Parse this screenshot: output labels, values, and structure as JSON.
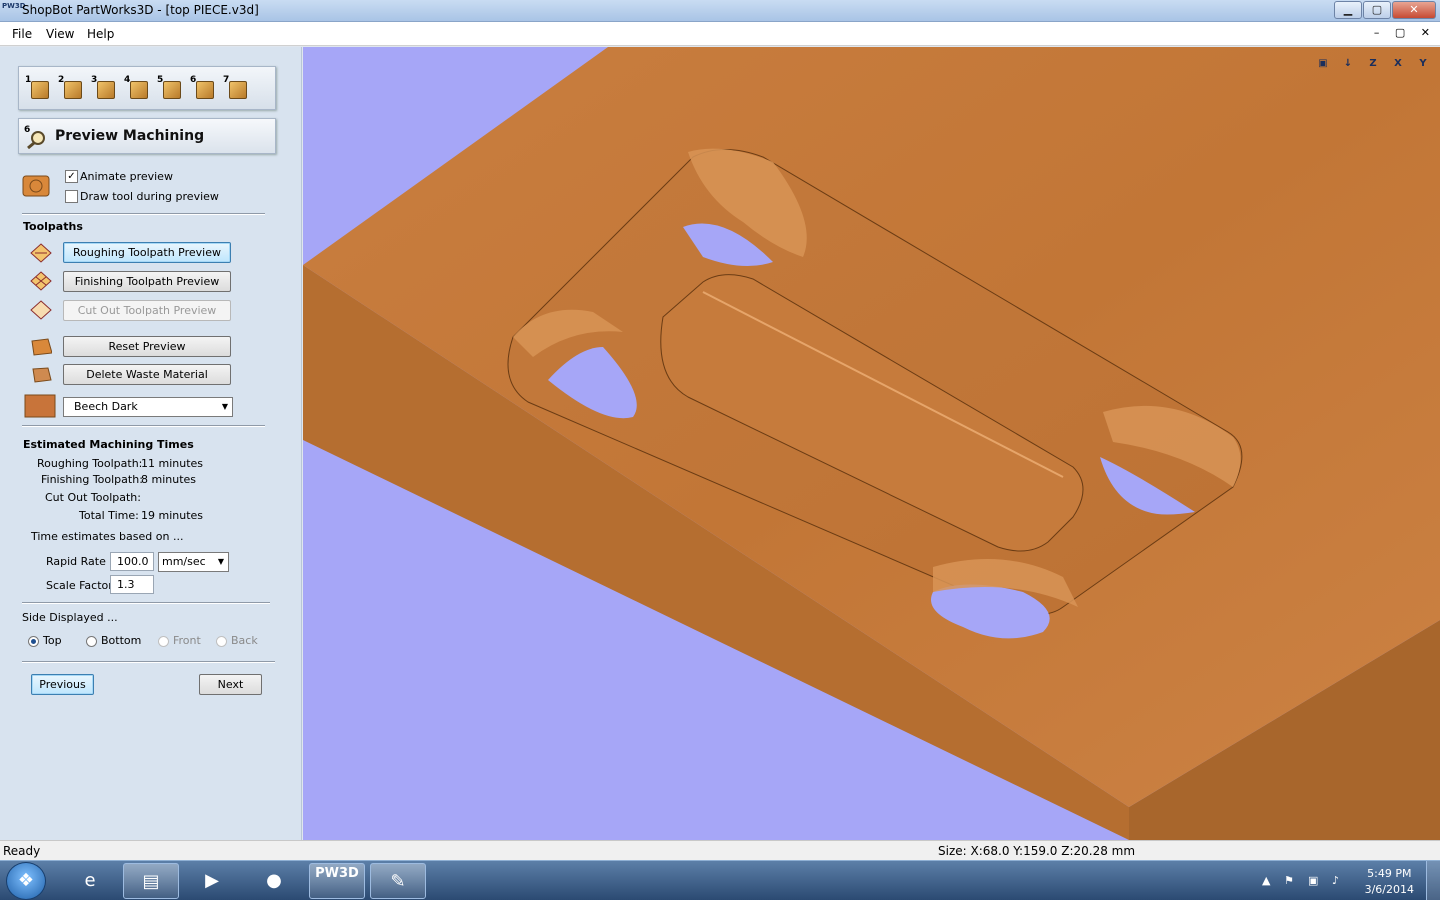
{
  "window": {
    "app_icon_text": "PW3D",
    "title": "ShopBot PartWorks3D - [top PIECE.v3d]",
    "minimize_glyph": "▁",
    "maximize_glyph": "▢",
    "close_glyph": "✕"
  },
  "menu": {
    "file": "File",
    "view": "View",
    "help": "Help",
    "mdi_controls": "–  ▢  ✕"
  },
  "steps": [
    "1",
    "2",
    "3",
    "4",
    "5",
    "6",
    "7"
  ],
  "panel": {
    "title_num": "6",
    "title": "Preview Machining",
    "animate_preview": "Animate preview",
    "animate_checked": "✓",
    "draw_tool": "Draw tool during preview",
    "toolpaths_heading": "Toolpaths",
    "roughing_btn": "Roughing Toolpath Preview",
    "finishing_btn": "Finishing Toolpath Preview",
    "cutout_btn": "Cut Out Toolpath Preview",
    "reset_btn": "Reset Preview",
    "delete_btn": "Delete Waste Material",
    "material_select": "Beech Dark",
    "times_heading": "Estimated Machining Times",
    "roughing_label": "Roughing Toolpath:",
    "roughing_value": "11 minutes",
    "finishing_label": "Finishing Toolpath:",
    "finishing_value": "8 minutes",
    "cutout_label": "Cut Out Toolpath:",
    "cutout_value": "",
    "total_label": "Total Time:",
    "total_value": "19 minutes",
    "based_on": "Time estimates based on ...",
    "rapid_label": "Rapid Rate",
    "rapid_value": "100.0",
    "rapid_unit": "mm/sec",
    "scale_label": "Scale Factor",
    "scale_value": "1.3",
    "side_heading": "Side Displayed ...",
    "side_top": "Top",
    "side_bottom": "Bottom",
    "side_front": "Front",
    "side_back": "Back",
    "prev_btn": "Previous",
    "next_btn": "Next"
  },
  "view_tools": [
    "▣",
    "↓",
    "Z",
    "X",
    "Y"
  ],
  "status": {
    "left": "Ready",
    "right": "Size: X:68.0 Y:159.0 Z:20.28 mm"
  },
  "taskbar": {
    "start_glyph": "❖",
    "ie_glyph": "e",
    "explorer_glyph": "▤",
    "media_glyph": "▶",
    "firefox_glyph": "●",
    "pw3d_text": "PW3D",
    "paint_glyph": "✎",
    "tray_arrow": "▲",
    "time": "5:49 PM",
    "date": "3/6/2014"
  },
  "colors": {
    "viewport_bg": "#a6a6f7",
    "wood_top": "#c57a3c",
    "wood_side": "#b06a2c",
    "wood_front": "#a3612a"
  }
}
